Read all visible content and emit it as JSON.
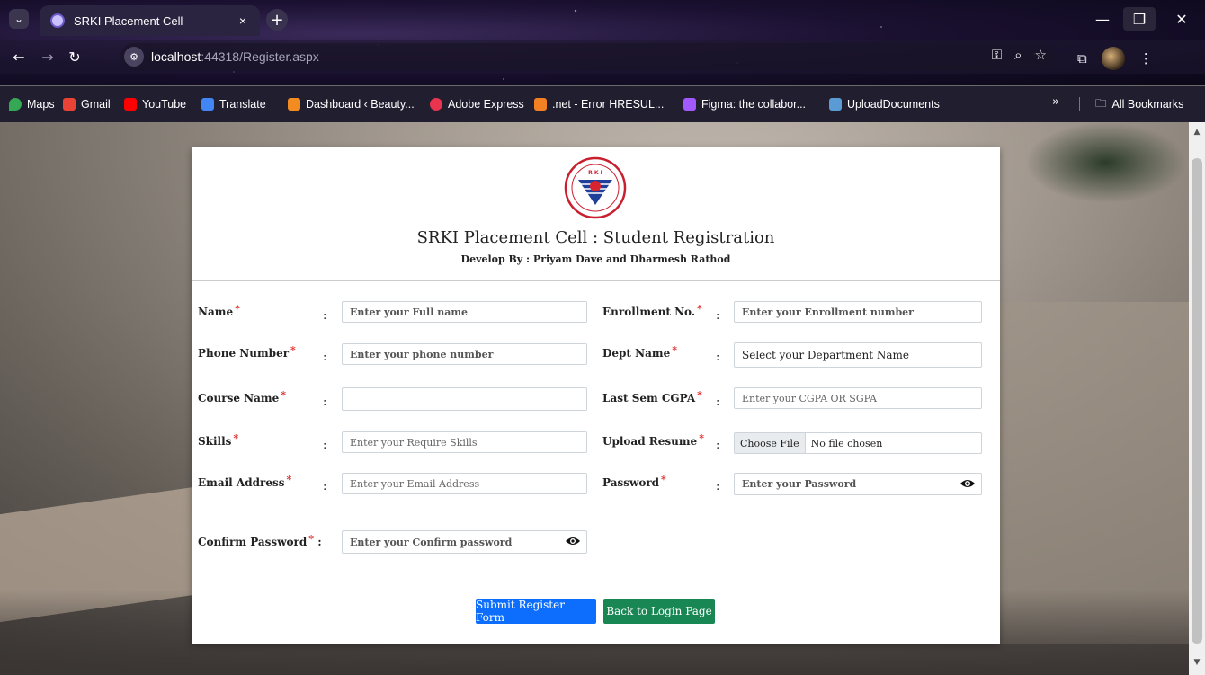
{
  "browser": {
    "tab_title": "SRKI Placement Cell",
    "tab_close": "×",
    "new_tab": "+",
    "url_host": "localhost",
    "url_rest": ":44318/Register.aspx",
    "bookmarks": [
      {
        "label": "Maps",
        "color": "#34a853"
      },
      {
        "label": "Gmail",
        "color": "#ea4335"
      },
      {
        "label": "YouTube",
        "color": "#ff0000"
      },
      {
        "label": "Translate",
        "color": "#4285f4"
      },
      {
        "label": "Dashboard ‹ Beauty...",
        "color": "#f28b20"
      },
      {
        "label": "Adobe Express",
        "color": "#e8344e"
      },
      {
        "label": ".net - Error HRESUL...",
        "color": "#f48024"
      },
      {
        "label": "Figma: the collabor...",
        "color": "#a259ff"
      },
      {
        "label": "UploadDocuments",
        "color": "#5b9bd5"
      }
    ],
    "bookmarks_more": "»",
    "all_bookmarks": "All Bookmarks"
  },
  "header": {
    "title": "SRKI Placement Cell : Student Registration",
    "subtitle": "Develop By : Priyam Dave and Dharmesh Rathod",
    "logo_text": "R K I"
  },
  "form": {
    "name_label": "Name",
    "name_placeholder": "Enter your Full name",
    "phone_label": "Phone Number",
    "phone_placeholder": "Enter your phone number",
    "course_label": "Course Name",
    "course_value": "",
    "skills_label": "Skills",
    "skills_placeholder": "Enter your Require Skills",
    "email_label": "Email Address",
    "email_placeholder": "Enter your Email Address",
    "confirm_label": "Confirm Password",
    "confirm_placeholder": "Enter your Confirm password",
    "enroll_label": "Enrollment No.",
    "enroll_placeholder": "Enter your Enrollment number",
    "dept_label": "Dept Name",
    "dept_value": "Select your Department Name",
    "cgpa_label": "Last Sem CGPA",
    "cgpa_placeholder": "Enter your CGPA OR SGPA",
    "resume_label": "Upload Resume",
    "resume_button": "Choose File",
    "resume_status": "No file chosen",
    "password_label": "Password",
    "password_placeholder": "Enter your Password",
    "required_mark": "*",
    "colon": ":"
  },
  "actions": {
    "submit_label": "Submit Register Form",
    "back_label": "Back to Login Page"
  },
  "colors": {
    "submit": "#0d6efd",
    "back": "#198754",
    "required": "#e03030"
  }
}
